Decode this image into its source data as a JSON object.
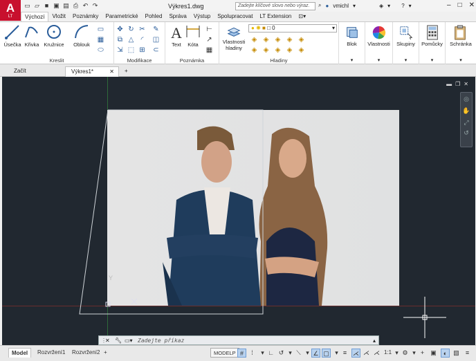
{
  "app": {
    "logo": "A",
    "logo_sub": "LT"
  },
  "title": "Výkres1.dwg",
  "search": {
    "placeholder": "Zadejte klíčové slovo nebo výraz."
  },
  "user": {
    "name": "vmichl"
  },
  "ribbon_tabs": [
    "Výchozí",
    "Vložit",
    "Poznámky",
    "Parametrické",
    "Pohled",
    "Správa",
    "Výstup",
    "Spolupracovat",
    "LT Extension"
  ],
  "panels": {
    "kreslit": {
      "label": "Kreslit",
      "buttons": [
        "Úsečka",
        "Křivka",
        "Kružnice",
        "Oblouk"
      ]
    },
    "modifikace": {
      "label": "Modifikace"
    },
    "poznamka": {
      "label": "Poznámka",
      "buttons": [
        "Text",
        "Kóta"
      ]
    },
    "hladiny": {
      "label": "Hladiny",
      "btn": "Vlastnosti hladiny",
      "layer_value": "0"
    },
    "blok": {
      "label": "Blok"
    },
    "vlastnosti": {
      "label": "Vlastnosti"
    },
    "skupiny": {
      "label": "Skupiny"
    },
    "pomucky": {
      "label": "Pomůcky"
    },
    "schranka": {
      "label": "Schránka"
    }
  },
  "file_tabs": [
    "Začít",
    "Výkres1*"
  ],
  "command": {
    "placeholder": "Zadejte příkaz"
  },
  "layout_tabs": [
    "Model",
    "Rozvržení1",
    "Rozvržení2"
  ],
  "status": {
    "modelp": "MODELP",
    "scale": "1:1"
  },
  "ucs": {
    "y_label": "Y"
  },
  "colors": {
    "canvas": "#212830",
    "accent": "#c8102e",
    "ribbon_bg": "#ffffff"
  },
  "icons": [
    "new-icon",
    "open-icon",
    "save-icon",
    "print-icon",
    "undo-icon",
    "redo-icon",
    "search-icon",
    "user-icon",
    "help-icon",
    "close-icon",
    "minimize-icon",
    "maximize-icon"
  ]
}
